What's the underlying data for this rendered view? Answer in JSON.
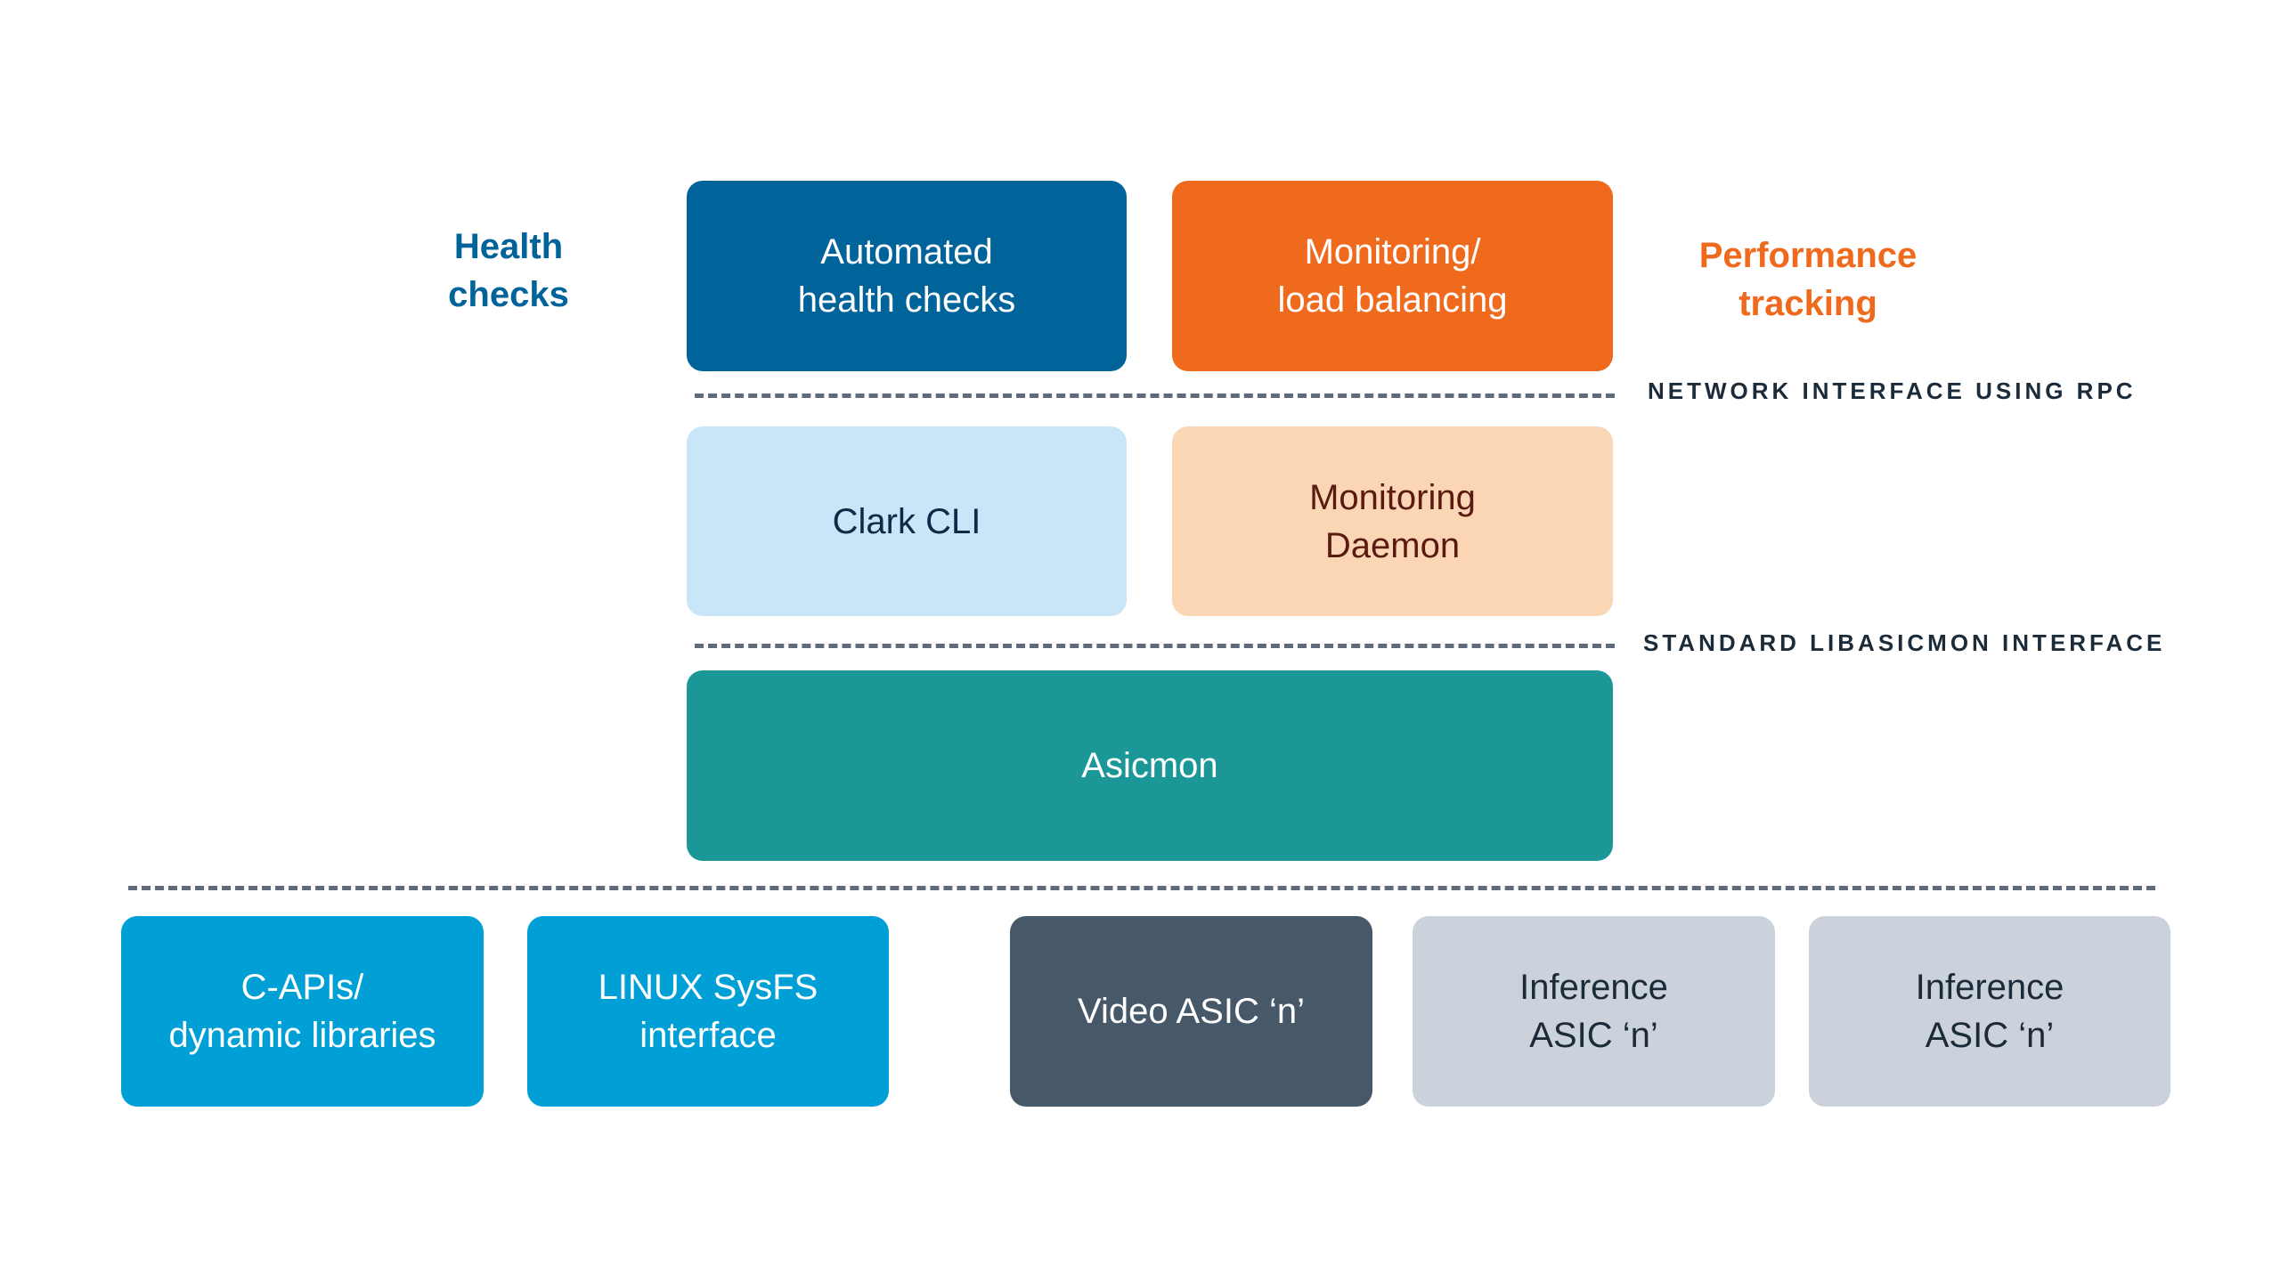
{
  "side_labels": {
    "health": {
      "text": "Health\nchecks",
      "color": "#00639a"
    },
    "performance": {
      "text": "Performance\ntracking",
      "color": "#ef6a1c"
    }
  },
  "interfaces": {
    "network": "NETWORK INTERFACE USING RPC",
    "standard": "STANDARD LIBASICMON INTERFACE"
  },
  "boxes": {
    "automated": {
      "text": "Automated\nhealth checks",
      "bg": "#00639a",
      "fg": "#ffffff"
    },
    "monitoring_lb": {
      "text": "Monitoring/\nload balancing",
      "bg": "#ef6a1c",
      "fg": "#ffffff"
    },
    "clark": {
      "text": "Clark CLI",
      "bg": "#c9e6f9",
      "fg": "#0d2a47"
    },
    "daemon": {
      "text": "Monitoring\nDaemon",
      "bg": "#fad6b5",
      "fg": "#5a1a10"
    },
    "asicmon": {
      "text": "Asicmon",
      "bg": "#1b9797",
      "fg": "#ffffff"
    },
    "capis": {
      "text": "C-APIs/\ndynamic libraries",
      "bg": "#00a0d6",
      "fg": "#ffffff"
    },
    "sysfs": {
      "text": "LINUX SysFS\ninterface",
      "bg": "#00a0d6",
      "fg": "#ffffff"
    },
    "video": {
      "text": "Video ASIC ‘n’",
      "bg": "#475969",
      "fg": "#ffffff"
    },
    "inference1": {
      "text": "Inference\nASIC ‘n’",
      "bg": "#cbd2db",
      "fg": "#1c2b39"
    },
    "inference2": {
      "text": "Inference\nASIC ‘n’",
      "bg": "#cbd2db",
      "fg": "#1c2b39"
    }
  }
}
